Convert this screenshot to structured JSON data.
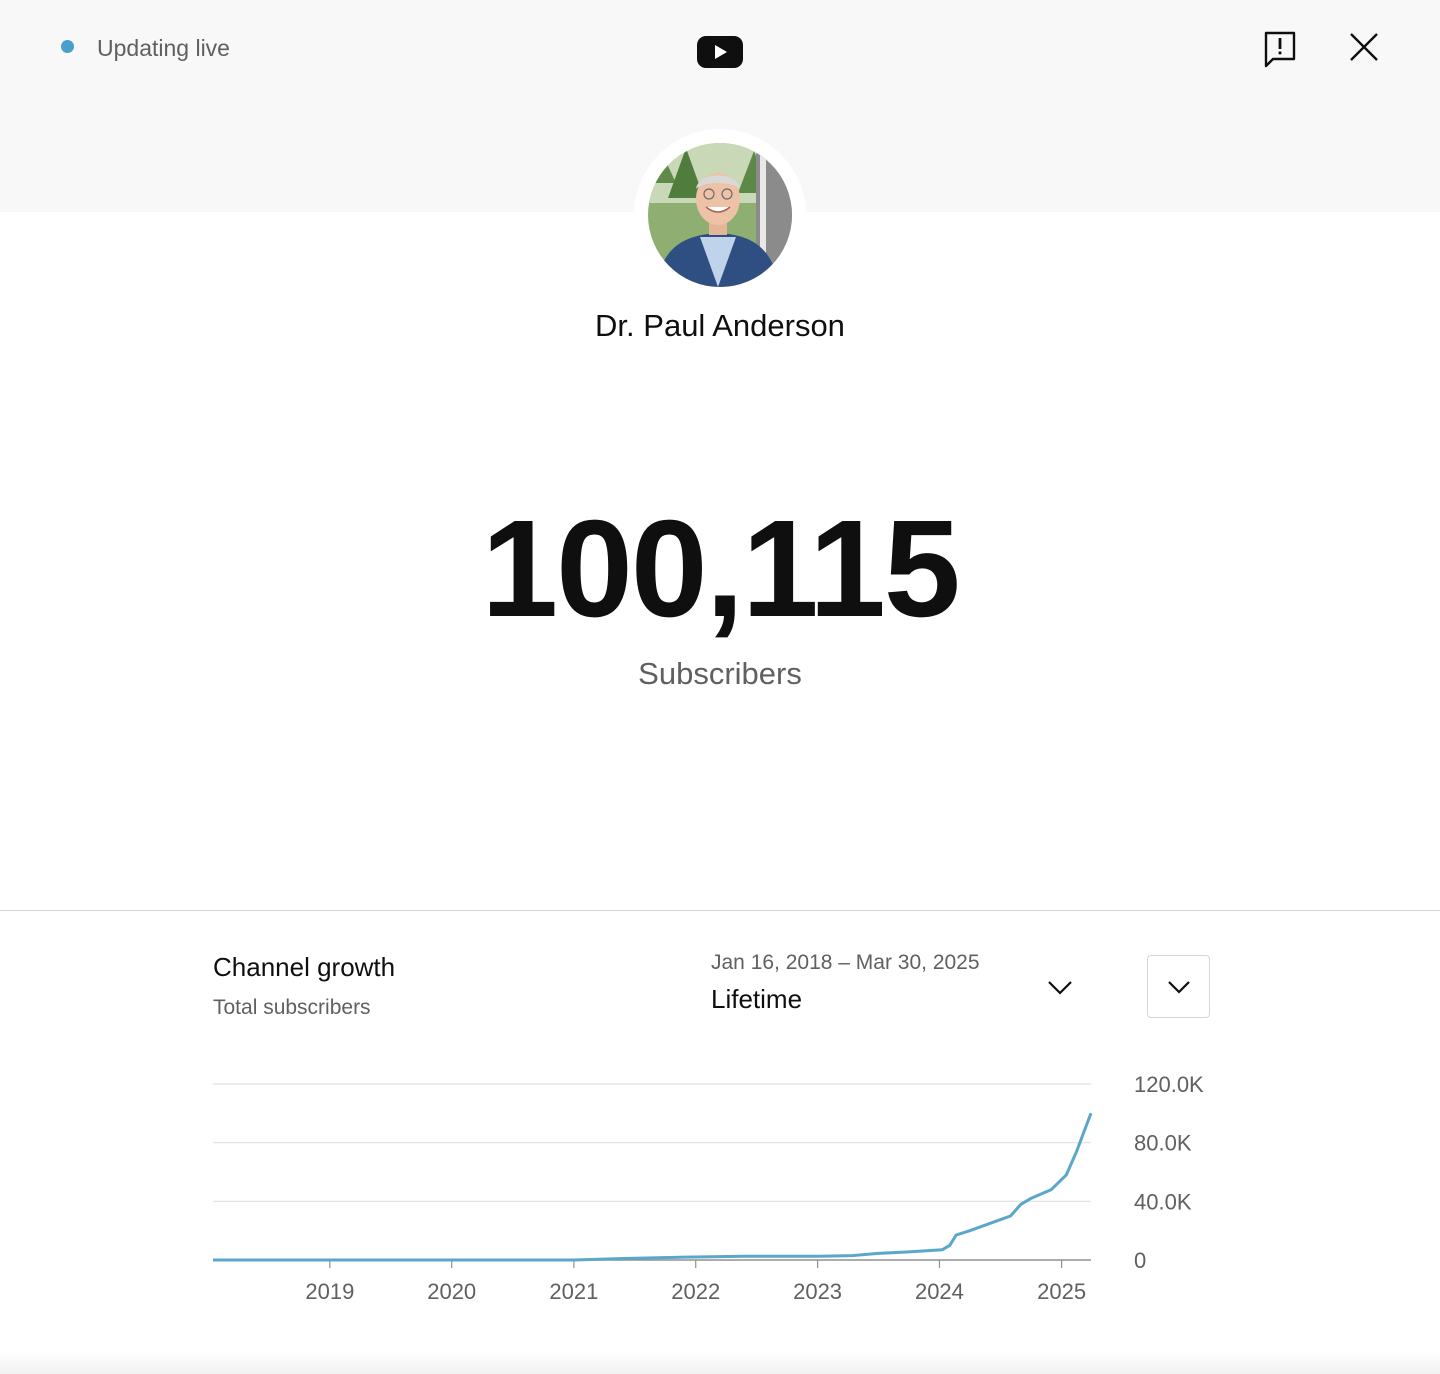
{
  "status": {
    "live_label": "Updating live",
    "live_color": "#4a9fca"
  },
  "icons": {
    "logo": "youtube-logo-icon",
    "feedback": "feedback-icon",
    "close": "close-icon",
    "range_dropdown": "chevron-down-icon",
    "expand": "chevron-down-icon"
  },
  "channel": {
    "name": "Dr. Paul Anderson"
  },
  "subscribers": {
    "count": "100,115",
    "label": "Subscribers"
  },
  "growth": {
    "title": "Channel growth",
    "subtitle": "Total subscribers",
    "date_range": "Jan 16, 2018 – Mar 30, 2025",
    "range_selected": "Lifetime"
  },
  "chart_data": {
    "type": "line",
    "title": "Channel growth",
    "subtitle": "Total subscribers",
    "x_start": "2018-01-16",
    "x_end": "2025-03-30",
    "xtick_labels": [
      "2019",
      "2020",
      "2021",
      "2022",
      "2023",
      "2024",
      "2025"
    ],
    "ytick_labels": [
      "120.0K",
      "80.0K",
      "40.0K",
      "0"
    ],
    "ylim": [
      0,
      120000
    ],
    "grid": true,
    "y_axis_side": "right",
    "line_color": "#5ba6cb",
    "series": [
      {
        "x": [
          "2018-01-16",
          "2019-01-01",
          "2020-01-01",
          "2021-01-01",
          "2021-06-01",
          "2021-12-01",
          "2022-06-01",
          "2023-01-01",
          "2023-04-15",
          "2023-07-01",
          "2023-10-01",
          "2024-01-10",
          "2024-02-01",
          "2024-02-20",
          "2024-04-01",
          "2024-06-01",
          "2024-08-01",
          "2024-09-01",
          "2024-10-01",
          "2024-12-01",
          "2025-01-15",
          "2025-02-15",
          "2025-03-10",
          "2025-03-30"
        ],
        "y": [
          0,
          0,
          0,
          0,
          1000,
          2000,
          2500,
          2600,
          3000,
          4500,
          5500,
          7000,
          10000,
          17000,
          20000,
          25000,
          30000,
          38000,
          42000,
          48000,
          58000,
          74000,
          88000,
          100115
        ]
      }
    ]
  }
}
